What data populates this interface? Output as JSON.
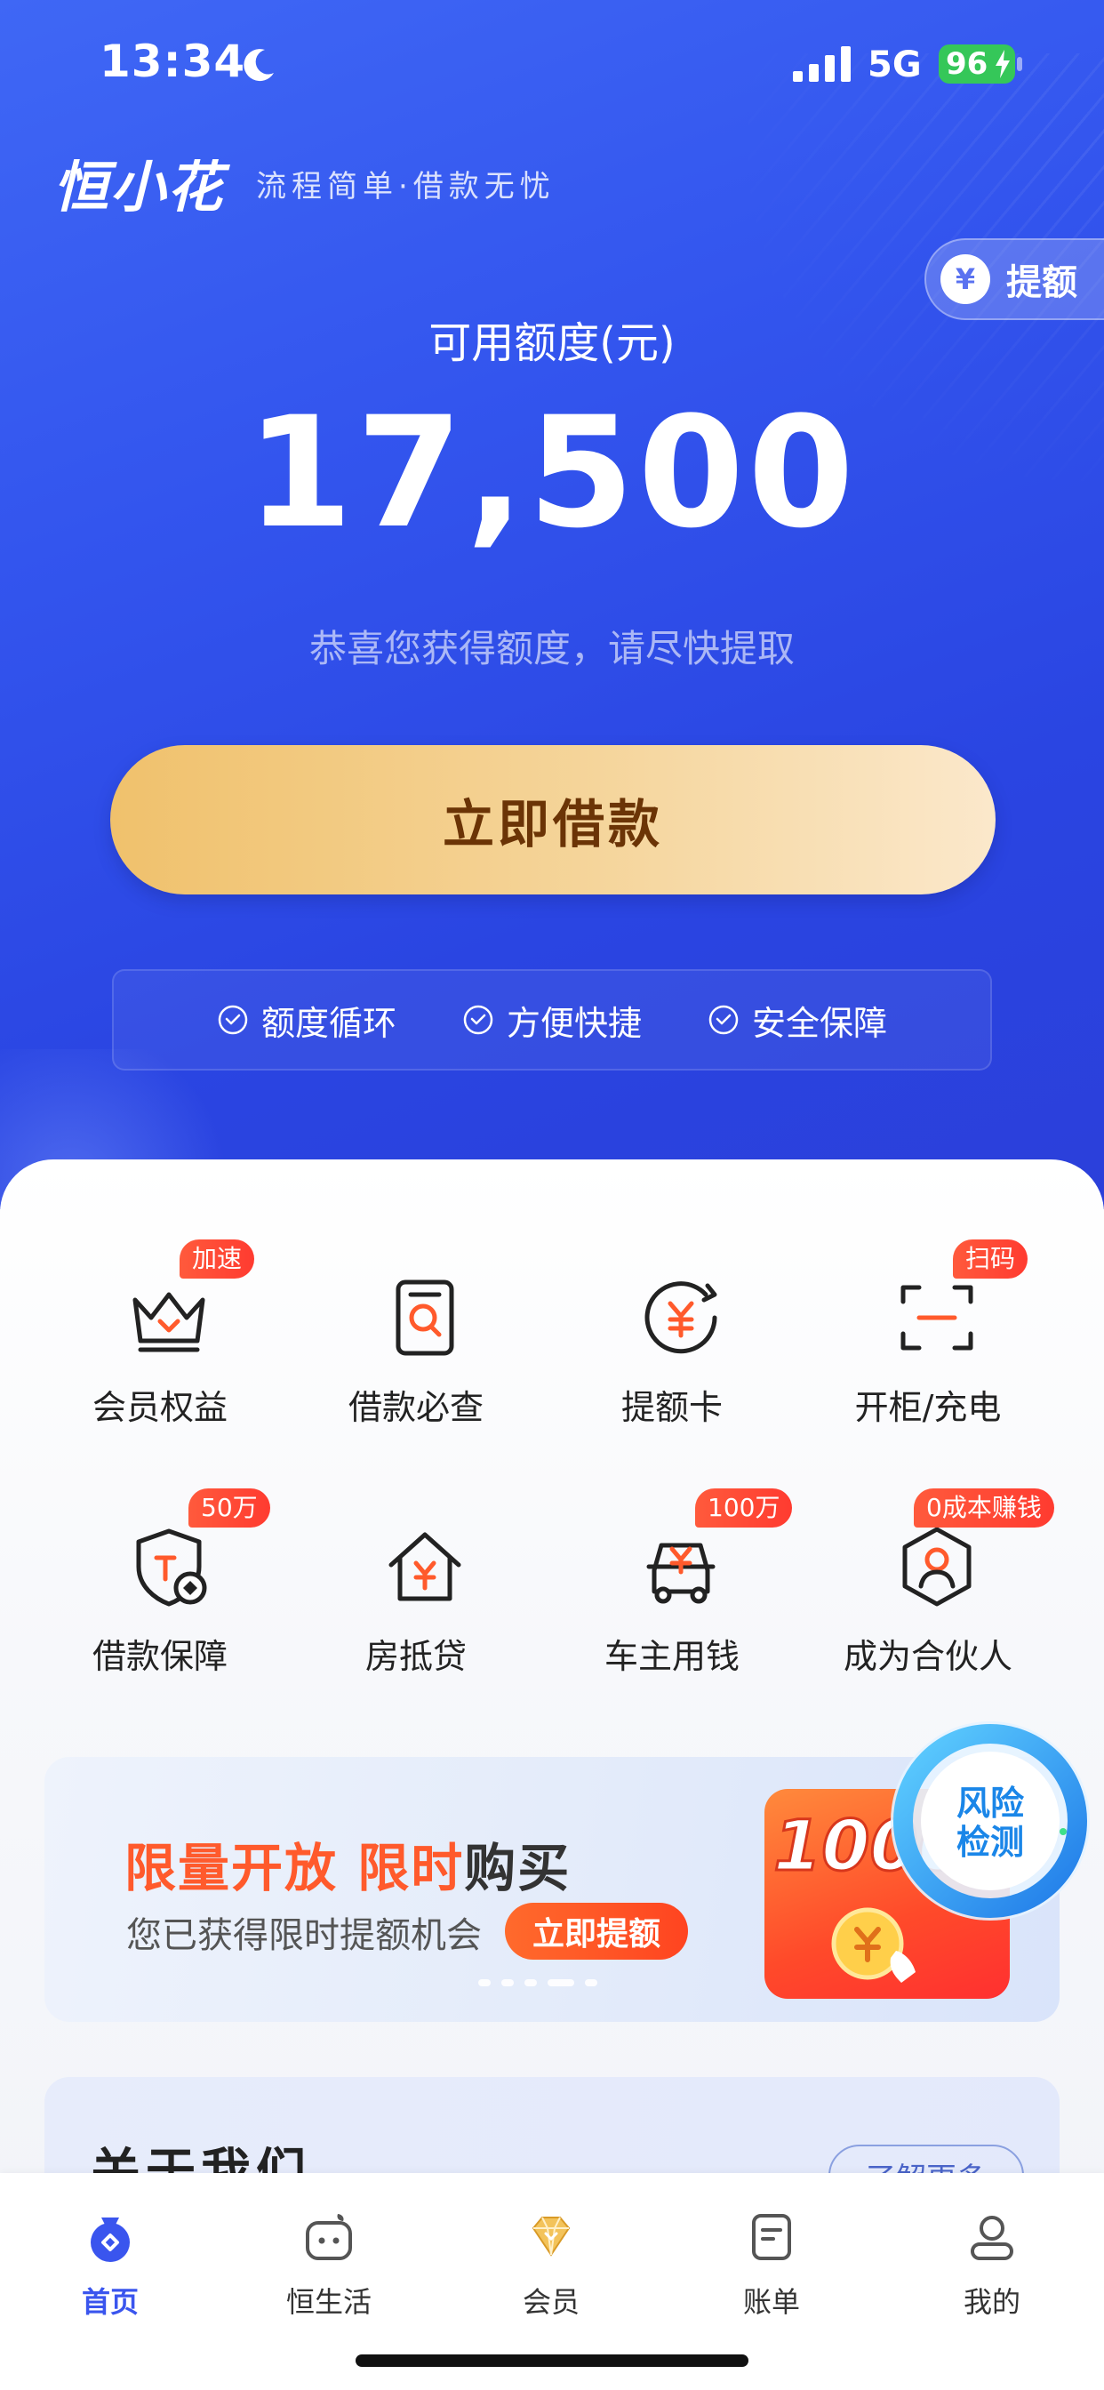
{
  "status_bar": {
    "time": "13:34",
    "network": "5G",
    "battery": "96"
  },
  "brand": {
    "logo": "恒小花",
    "slogan": "流程简单·借款无忧"
  },
  "raise_pill": {
    "label": "提额",
    "icon": "yen-icon"
  },
  "quota": {
    "label": "可用额度(元)",
    "amount": "17,500",
    "tip": "恭喜您获得额度，请尽快提取"
  },
  "borrow_button": {
    "label": "立即借款"
  },
  "features": [
    {
      "label": "额度循环",
      "icon": "check-circle-icon"
    },
    {
      "label": "方便快捷",
      "icon": "check-circle-icon"
    },
    {
      "label": "安全保障",
      "icon": "check-circle-icon"
    }
  ],
  "services": [
    {
      "label": "会员权益",
      "tag": "加速",
      "icon": "crown-icon"
    },
    {
      "label": "借款必查",
      "tag": "",
      "icon": "document-search-icon"
    },
    {
      "label": "提额卡",
      "tag": "",
      "icon": "yen-card-icon"
    },
    {
      "label": "开柜/充电",
      "tag": "扫码",
      "icon": "scan-icon"
    },
    {
      "label": "借款保障",
      "tag": "50万",
      "icon": "shield-icon"
    },
    {
      "label": "房抵贷",
      "tag": "",
      "icon": "house-yen-icon"
    },
    {
      "label": "车主用钱",
      "tag": "100万",
      "icon": "car-yen-icon"
    },
    {
      "label": "成为合伙人",
      "tag": "0成本赚钱",
      "icon": "partner-icon"
    }
  ],
  "promo": {
    "title_highlight1": "限量开放 ",
    "title_highlight2": "限时",
    "title_rest": "购买",
    "subtitle": "您已获得限时提额机会",
    "button": "立即提额",
    "coupon_value": "1000",
    "active_dot": 4
  },
  "risk_detect": {
    "line1": "风险",
    "line2": "检测"
  },
  "about": {
    "title": "关于我们",
    "more": "了解更多"
  },
  "tabs": [
    {
      "label": "首页",
      "icon": "home-bag-icon",
      "active": true
    },
    {
      "label": "恒生活",
      "icon": "life-icon",
      "active": false
    },
    {
      "label": "会员",
      "icon": "diamond-icon",
      "active": false
    },
    {
      "label": "账单",
      "icon": "bill-icon",
      "active": false
    },
    {
      "label": "我的",
      "icon": "profile-icon",
      "active": false
    }
  ],
  "colors": {
    "primary": "#3a55ee",
    "gold": "#f0c16c",
    "tag_red": "#ff3b30",
    "promo_orange": "#ff5a2c"
  }
}
